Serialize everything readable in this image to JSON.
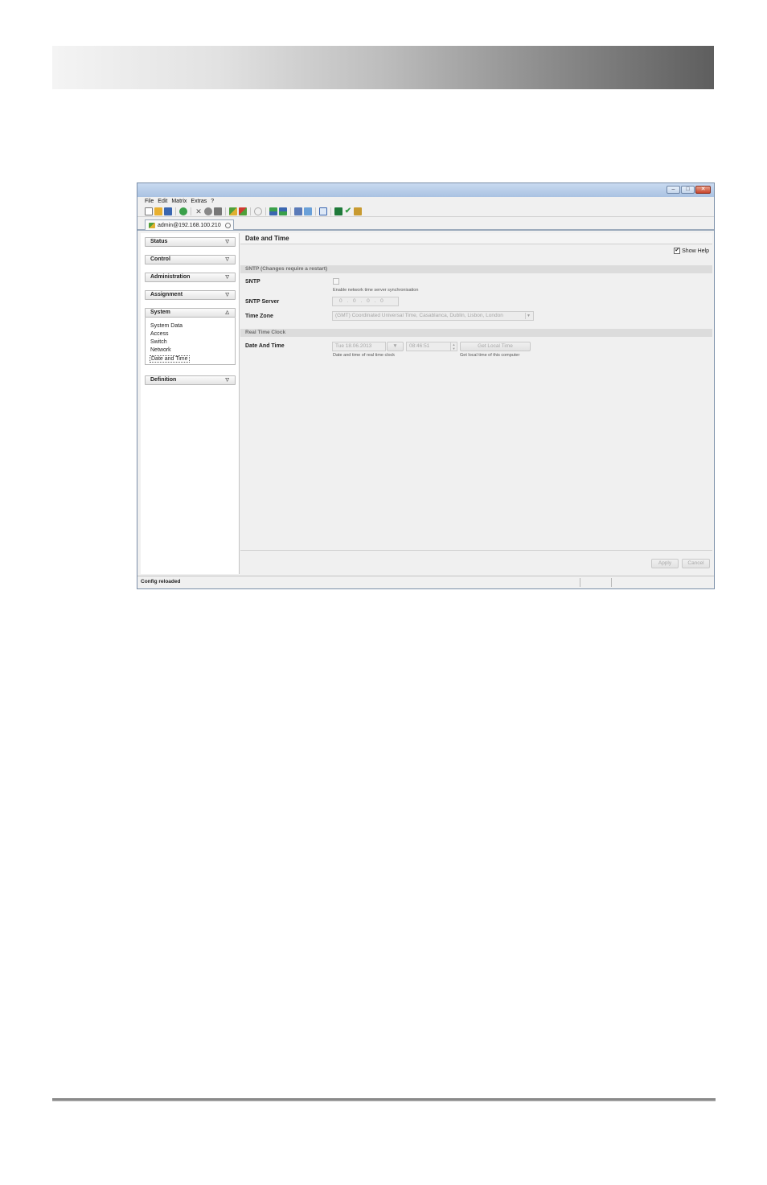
{
  "menu": {
    "items": [
      "File",
      "Edit",
      "Matrix",
      "Extras",
      "?"
    ]
  },
  "toolbar": {
    "icons": [
      "new-file-icon",
      "open-folder-icon",
      "save-icon",
      "reload-icon",
      "cut-icon",
      "copy-icon",
      "paste-icon",
      "connect-icon",
      "disconnect-icon",
      "activate-icon",
      "upload-icon",
      "download-icon",
      "export-icon",
      "import-icon",
      "report-icon",
      "matrix-icon",
      "check-icon",
      "tool-icon"
    ]
  },
  "connection_tab": {
    "label": "admin@192.168.100.210"
  },
  "sidebar": {
    "sections": [
      "Status",
      "Control",
      "Administration",
      "Assignment",
      "System",
      "Definition"
    ],
    "system_items": [
      "System Data",
      "Access",
      "Switch",
      "Network",
      "Date and Time"
    ],
    "selected_item": "Date and Time"
  },
  "content": {
    "title": "Date and Time",
    "show_help_label": "Show Help",
    "show_help_checked": true,
    "sntp_section": "SNTP (Changes require a restart)",
    "sntp_label": "SNTP",
    "sntp_help": "Enable network time server synchronisation",
    "sntp_server_label": "SNTP Server",
    "sntp_server_value": "0 . 0 . 0 . 0",
    "time_zone_label": "Time Zone",
    "time_zone_value": "(GMT) Coordinated Universal Time, Casablanca, Dublin, Lisbon, London",
    "rtc_section": "Real Time Clock",
    "date_time_label": "Date And Time",
    "date_value": "Tue   18.06.2013",
    "time_value": "08:46:51",
    "get_local_time_label": "Get Local Time",
    "date_help": "Date and time of real time clock",
    "local_time_help": "Get local time of this computer"
  },
  "footer": {
    "apply_label": "Apply",
    "cancel_label": "Cancel"
  },
  "status_bar": {
    "message": "Config reloaded"
  }
}
